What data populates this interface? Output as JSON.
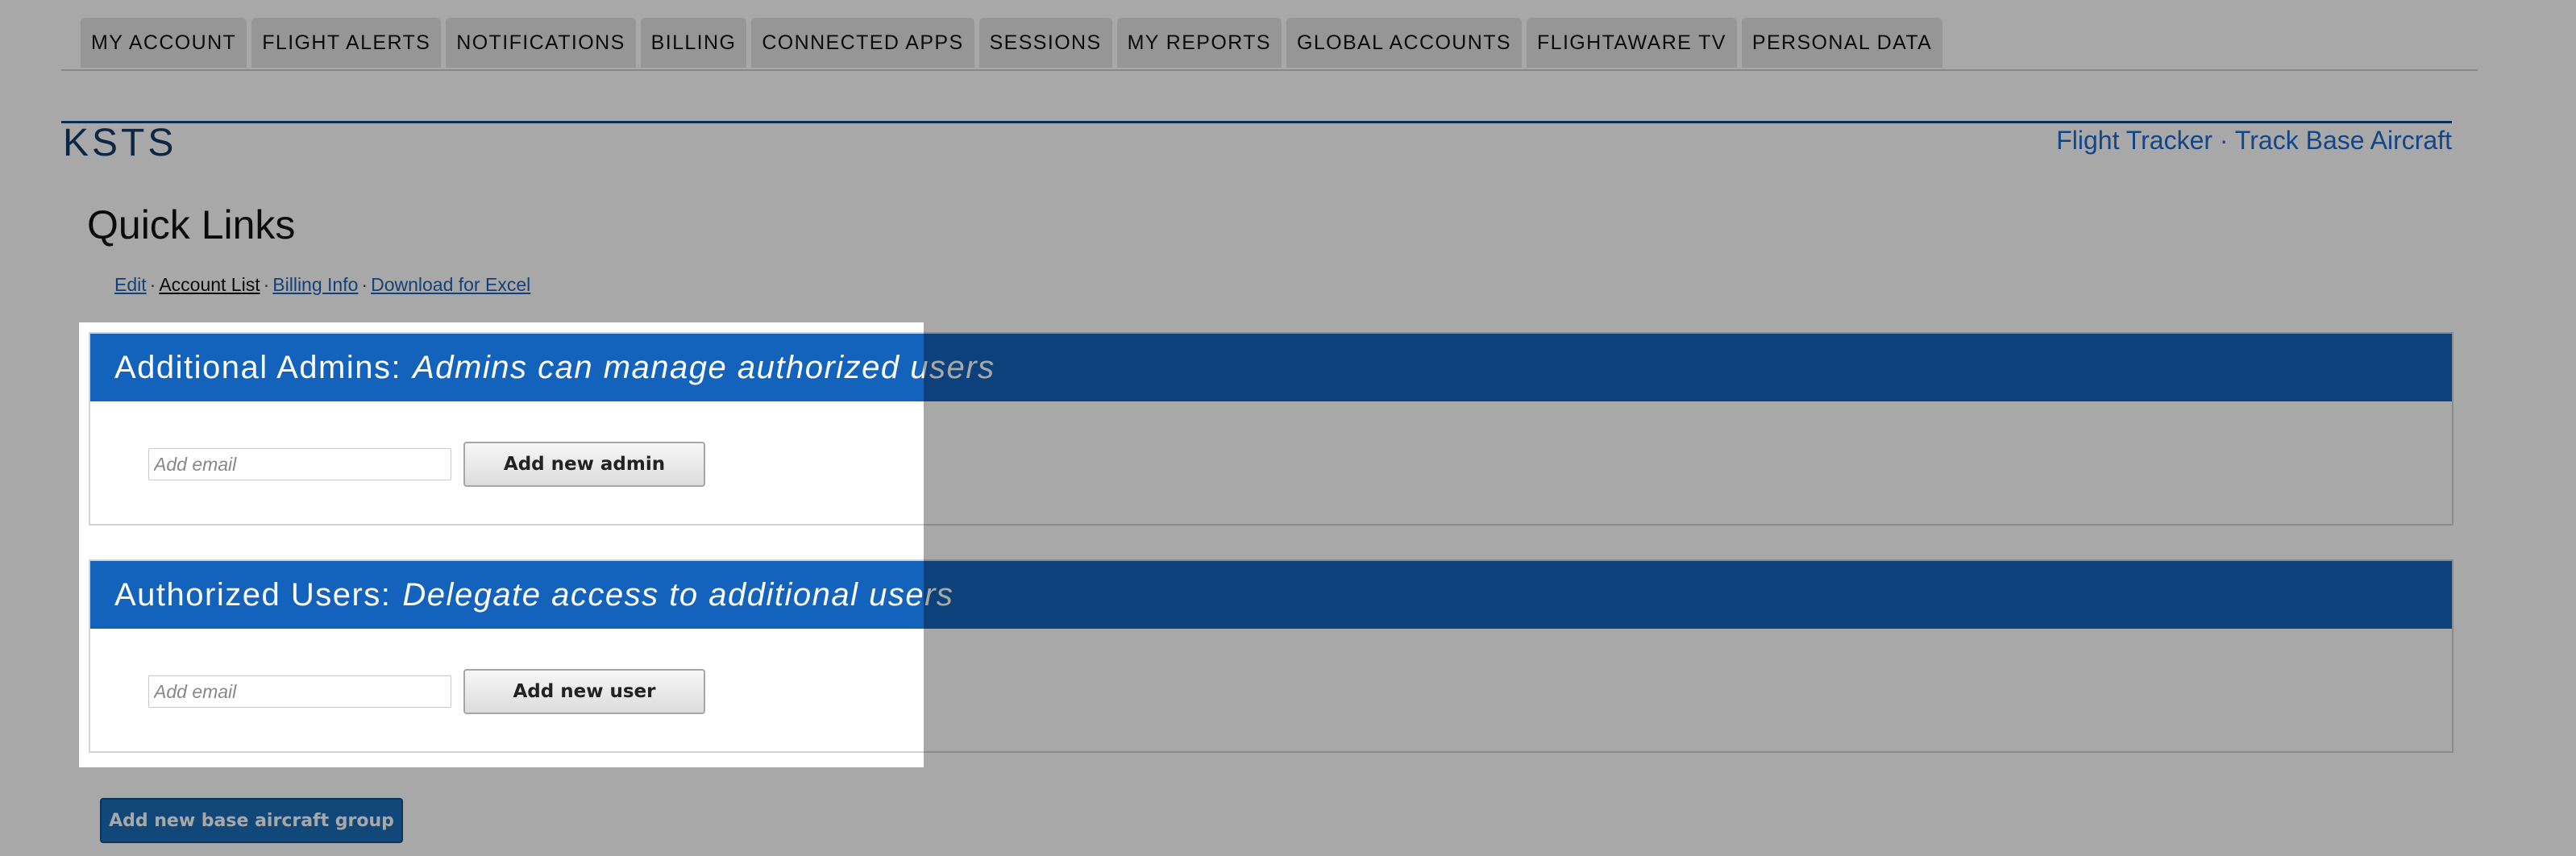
{
  "tabs": [
    "MY ACCOUNT",
    "FLIGHT ALERTS",
    "NOTIFICATIONS",
    "BILLING",
    "CONNECTED APPS",
    "SESSIONS",
    "MY REPORTS",
    "GLOBAL ACCOUNTS",
    "FLIGHTAWARE TV",
    "PERSONAL DATA"
  ],
  "header": {
    "title": "KSTS",
    "links": [
      "Flight Tracker",
      "Track Base Aircraft"
    ],
    "separator": "·"
  },
  "quick_links": {
    "heading": "Quick Links",
    "items": [
      "Edit",
      "Account List",
      "Billing Info",
      "Download for Excel"
    ],
    "separator": "·"
  },
  "admins_panel": {
    "title": "Additional Admins:",
    "subtitle": "Admins can manage authorized users",
    "input_placeholder": "Add email",
    "button_label": "Add new admin"
  },
  "users_panel": {
    "title": "Authorized Users:",
    "subtitle": "Delegate access to additional users",
    "input_placeholder": "Add email",
    "button_label": "Add new user"
  },
  "base_aircraft_button": "Add new base aircraft group",
  "colors": {
    "panel_header": "#1363bd",
    "title_navy": "#133a66",
    "link_blue": "#1d6ad0",
    "overlay": "rgba(0,0,0,0.34)"
  }
}
